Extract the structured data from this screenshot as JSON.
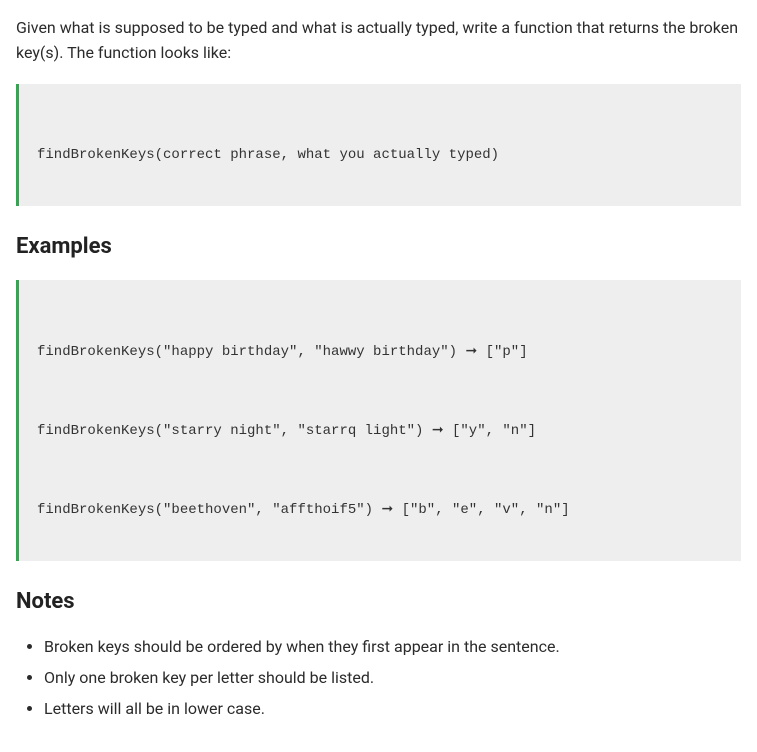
{
  "intro": "Given what is supposed to be typed and what is actually typed, write a function that returns the broken key(s). The function looks like:",
  "signature": "findBrokenKeys(correct phrase, what you actually typed)",
  "examples_heading": "Examples",
  "examples": [
    "findBrokenKeys(\"happy birthday\", \"hawwy birthday\") ➞ [\"p\"]",
    "findBrokenKeys(\"starry night\", \"starrq light\") ➞ [\"y\", \"n\"]",
    "findBrokenKeys(\"beethoven\", \"affthoif5\") ➞ [\"b\", \"e\", \"v\", \"n\"]"
  ],
  "notes_heading": "Notes",
  "notes": [
    "Broken keys should be ordered by when they first appear in the sentence.",
    "Only one broken key per letter should be listed.",
    "Letters will all be in lower case."
  ]
}
